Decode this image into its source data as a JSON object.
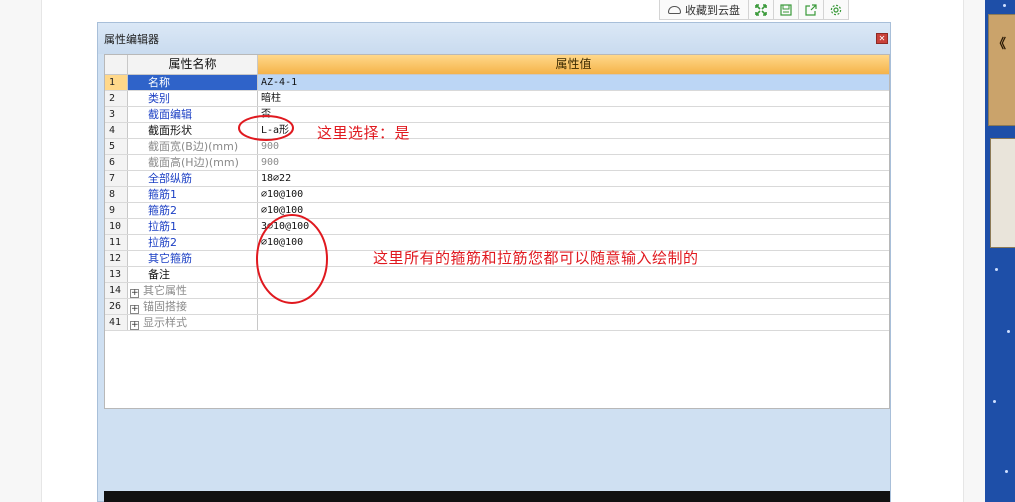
{
  "toolbar": {
    "save_to_cloud_label": "收藏到云盘",
    "icons": [
      "expand-icon",
      "save-icon",
      "share-icon",
      "settings-icon"
    ]
  },
  "editor": {
    "title": "属性编辑器",
    "columns": {
      "name": "属性名称",
      "value": "属性值"
    },
    "rows": [
      {
        "num": "1",
        "name": "名称",
        "value": "AZ-4-1",
        "style": "blue",
        "selected": true
      },
      {
        "num": "2",
        "name": "类别",
        "value": "暗柱",
        "style": "blue"
      },
      {
        "num": "3",
        "name": "截面编辑",
        "value": "否",
        "style": "blue"
      },
      {
        "num": "4",
        "name": "截面形状",
        "value": "L-a形",
        "style": "black"
      },
      {
        "num": "5",
        "name": "截面宽(B边)(mm)",
        "value": "900",
        "style": "gray"
      },
      {
        "num": "6",
        "name": "截面高(H边)(mm)",
        "value": "900",
        "style": "gray"
      },
      {
        "num": "7",
        "name": "全部纵筋",
        "value": "18⌀22",
        "style": "blue"
      },
      {
        "num": "8",
        "name": "箍筋1",
        "value": "⌀10@100",
        "style": "blue"
      },
      {
        "num": "9",
        "name": "箍筋2",
        "value": "⌀10@100",
        "style": "blue"
      },
      {
        "num": "10",
        "name": "拉筋1",
        "value": "3⌀10@100",
        "style": "blue"
      },
      {
        "num": "11",
        "name": "拉筋2",
        "value": "⌀10@100",
        "style": "blue"
      },
      {
        "num": "12",
        "name": "其它箍筋",
        "value": "",
        "style": "blue"
      },
      {
        "num": "13",
        "name": "备注",
        "value": "",
        "style": "black"
      },
      {
        "num": "14",
        "name": "其它属性",
        "value": "",
        "style": "group"
      },
      {
        "num": "26",
        "name": "锚固搭接",
        "value": "",
        "style": "group"
      },
      {
        "num": "41",
        "name": "显示样式",
        "value": "",
        "style": "group"
      }
    ]
  },
  "annotations": {
    "note1": "这里选择：是",
    "note2": "这里所有的箍筋和拉筋您都可以随意输入绘制的",
    "color": "#e0191f"
  },
  "sidebar_ad": {
    "text": "《"
  }
}
